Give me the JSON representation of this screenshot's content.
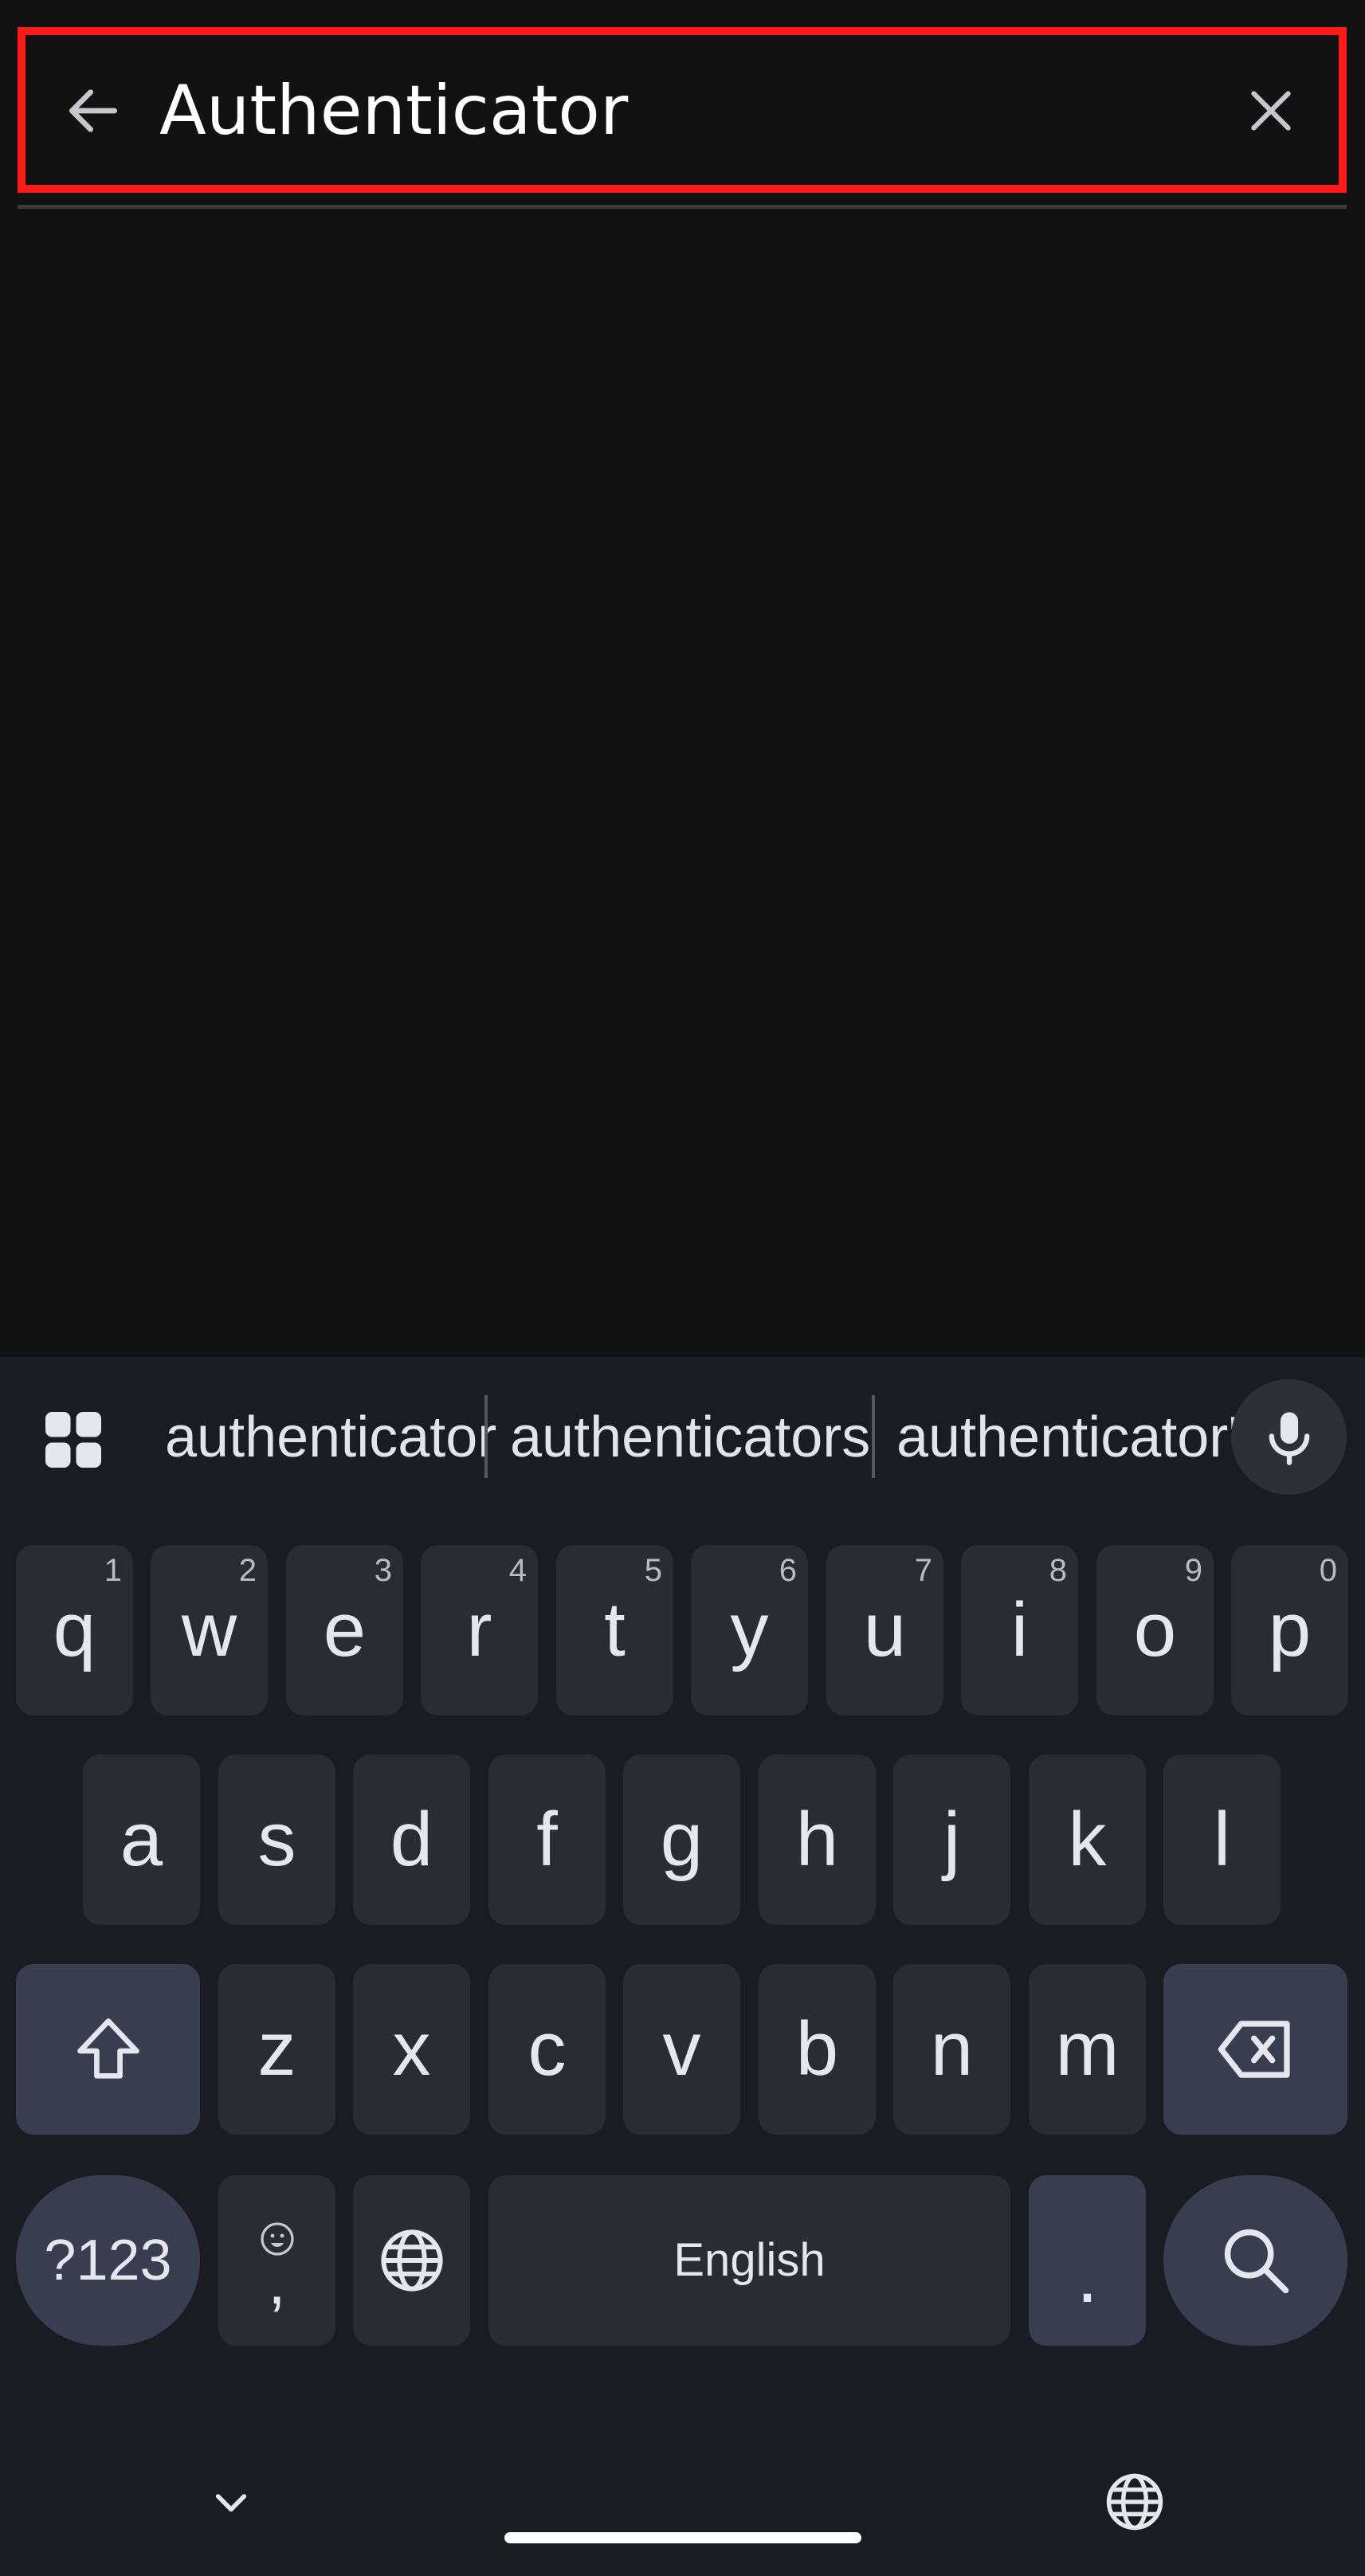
{
  "search": {
    "query": "Authenticator"
  },
  "icons": {
    "back": "arrow-left-icon",
    "clear": "close-icon",
    "apps": "apps-grid-icon",
    "mic": "microphone-icon",
    "shift": "shift-icon",
    "backspace": "backspace-icon",
    "globe": "globe-icon",
    "emoji": "emoji-icon",
    "search": "search-icon",
    "hide_keyboard": "chevron-down-icon"
  },
  "colors": {
    "background": "#121213",
    "highlight_border": "#ff1a1a",
    "keyboard_bg": "#1b1c21",
    "key_bg": "#2b2c33",
    "mod_key_bg": "#3a3c4f",
    "key_text": "#e6e6ee"
  },
  "keyboard": {
    "suggestions": [
      "authenticator",
      "authenticators",
      "authenticator's"
    ],
    "row1": [
      {
        "label": "q",
        "hint": "1"
      },
      {
        "label": "w",
        "hint": "2"
      },
      {
        "label": "e",
        "hint": "3"
      },
      {
        "label": "r",
        "hint": "4"
      },
      {
        "label": "t",
        "hint": "5"
      },
      {
        "label": "y",
        "hint": "6"
      },
      {
        "label": "u",
        "hint": "7"
      },
      {
        "label": "i",
        "hint": "8"
      },
      {
        "label": "o",
        "hint": "9"
      },
      {
        "label": "p",
        "hint": "0"
      }
    ],
    "row2": [
      "a",
      "s",
      "d",
      "f",
      "g",
      "h",
      "j",
      "k",
      "l"
    ],
    "row3": [
      "z",
      "x",
      "c",
      "v",
      "b",
      "n",
      "m"
    ],
    "symbols_label": "?123",
    "comma_label": ",",
    "space_label": "English",
    "period_label": "."
  }
}
